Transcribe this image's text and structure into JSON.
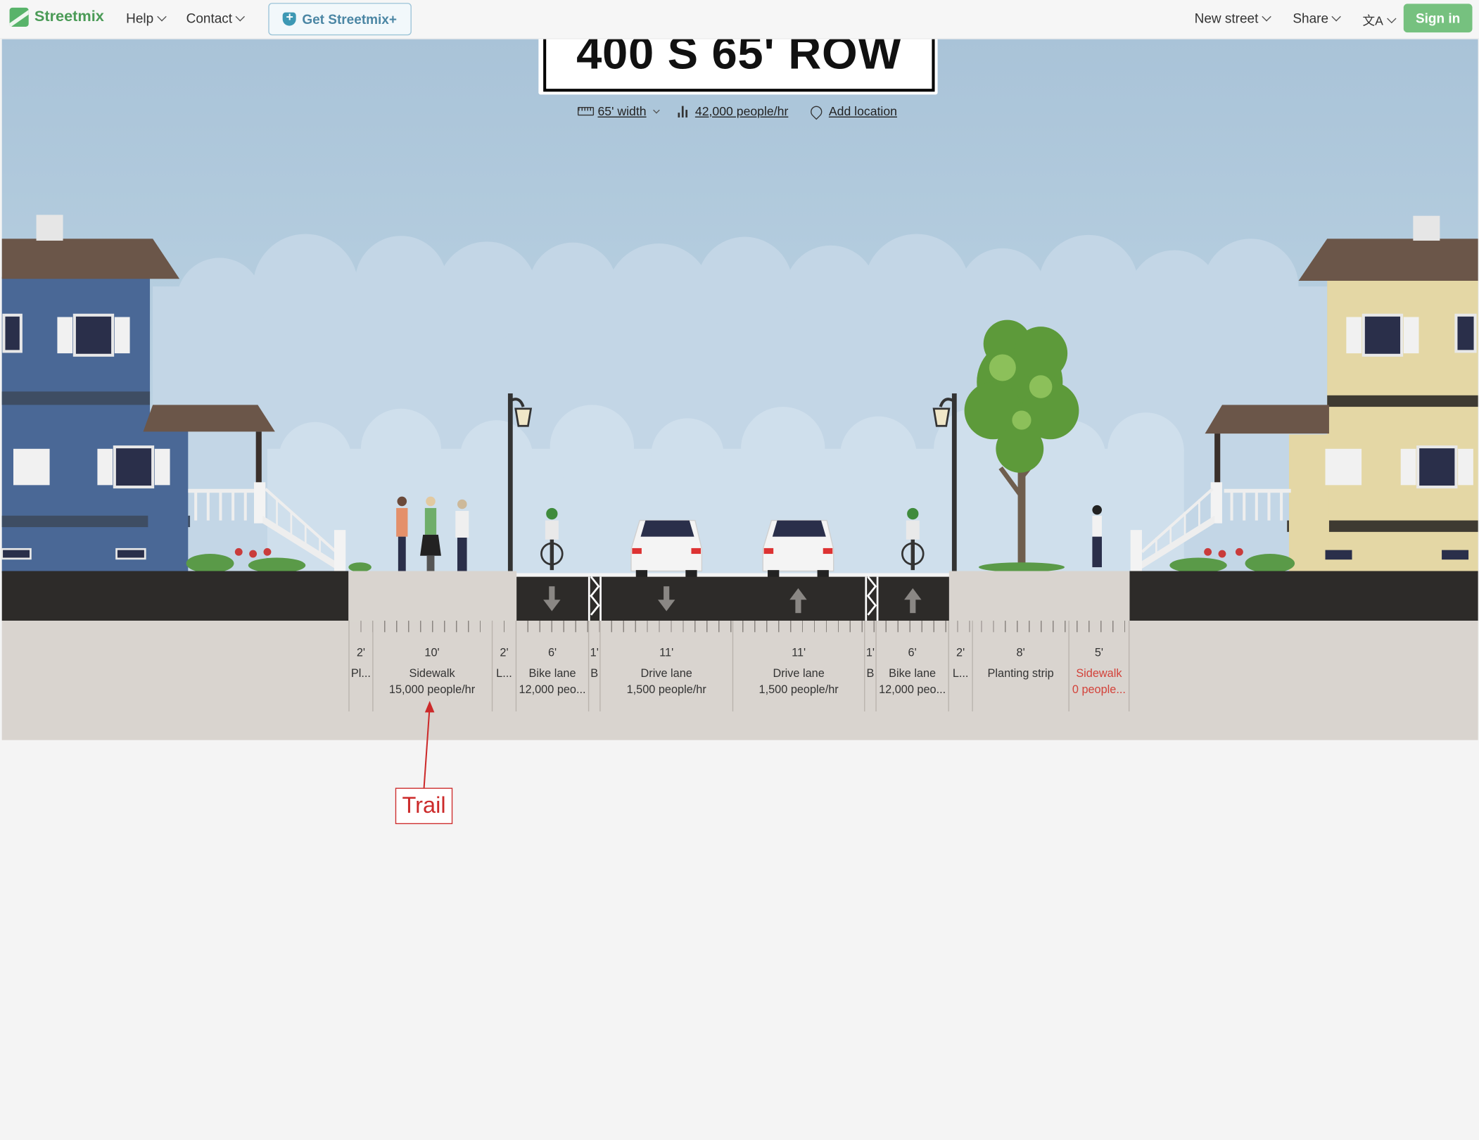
{
  "app": {
    "name": "Streetmix"
  },
  "nav": {
    "help": "Help",
    "contact": "Contact",
    "plus": "Get Streetmix+",
    "new_street": "New street",
    "share": "Share",
    "language_icon": "translate-icon",
    "signin": "Sign in"
  },
  "street": {
    "name": "400 S 65' ROW",
    "width": "65' width",
    "capacity": "42,000 people/hr",
    "location": "Add location"
  },
  "segments": [
    {
      "width": "2'",
      "name": "Pl...",
      "capacity": ""
    },
    {
      "width": "10'",
      "name": "Sidewalk",
      "capacity": "15,000 people/hr"
    },
    {
      "width": "2'",
      "name": "L...",
      "capacity": ""
    },
    {
      "width": "6'",
      "name": "Bike lane",
      "capacity": "12,000 peo..."
    },
    {
      "width": "1'",
      "name": "B",
      "capacity": ""
    },
    {
      "width": "11'",
      "name": "Drive lane",
      "capacity": "1,500 people/hr"
    },
    {
      "width": "11'",
      "name": "Drive lane",
      "capacity": "1,500 people/hr"
    },
    {
      "width": "1'",
      "name": "B",
      "capacity": ""
    },
    {
      "width": "6'",
      "name": "Bike lane",
      "capacity": "12,000 peo..."
    },
    {
      "width": "2'",
      "name": "L...",
      "capacity": ""
    },
    {
      "width": "8'",
      "name": "Planting strip",
      "capacity": ""
    },
    {
      "width": "5'",
      "name": "Sidewalk",
      "capacity": "0 people...",
      "warning": true
    }
  ],
  "annotation": {
    "text": "Trail"
  },
  "colors": {
    "brand": "#4b9b57",
    "signin": "#76c17f",
    "sky": "#b3cadc",
    "asphalt": "#2d2b29",
    "warning": "#d3423a",
    "annotation": "#cc2a2a"
  }
}
